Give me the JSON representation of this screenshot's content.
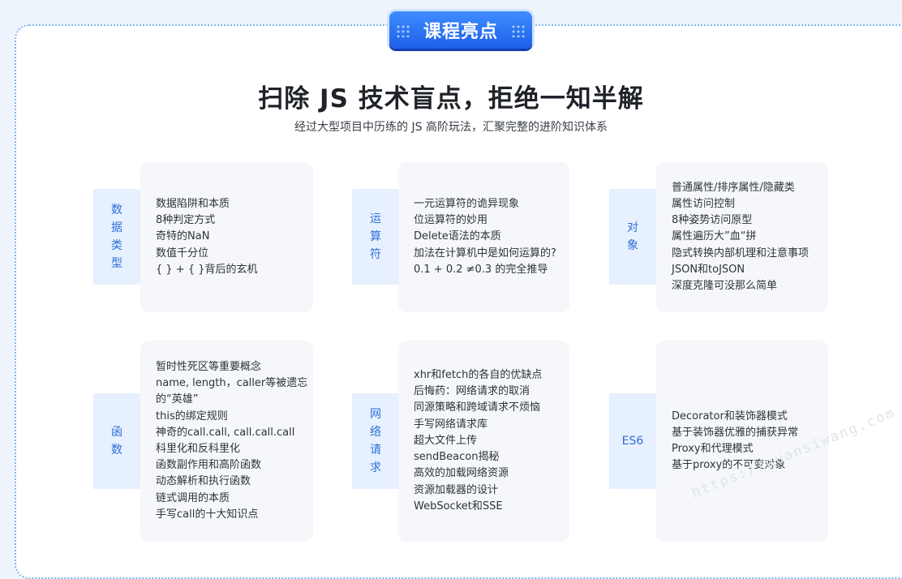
{
  "badge": "课程亮点",
  "title": "扫除 JS 技术盲点，拒绝一知半解",
  "subtitle": "经过大型项目中历练的 JS 高阶玩法，汇聚完整的进阶知识体系",
  "sections": [
    {
      "label_chars": [
        "数",
        "据",
        "类",
        "型"
      ],
      "items": [
        "数据陷阱和本质",
        "8种判定方式",
        "奇特的NaN",
        "数值千分位",
        "{ } + { }背后的玄机"
      ]
    },
    {
      "label_chars": [
        "运",
        "算",
        "符"
      ],
      "items": [
        "一元运算符的诡异现象",
        "位运算符的妙用",
        "Delete语法的本质",
        "加法在计算机中是如何运算的?",
        "0.1 + 0.2 ≠0.3 的完全推导"
      ]
    },
    {
      "label_chars": [
        "对",
        "象"
      ],
      "items": [
        "普通属性/排序属性/隐藏类",
        "属性访问控制",
        "8种姿势访问原型",
        "属性遍历大”血“拼",
        "隐式转换内部机理和注意事项",
        "JSON和toJSON",
        "深度克隆可没那么简单"
      ]
    },
    {
      "label_chars": [
        "函",
        "数"
      ],
      "items": [
        "暂时性死区等重要概念",
        "name, length，caller等被遗忘",
        "的“英雄”",
        "this的绑定规则",
        "神奇的call.call, call.call.call",
        "科里化和反科里化",
        "函数副作用和高阶函数",
        "动态解析和执行函数",
        "链式调用的本质",
        "手写call的十大知识点"
      ]
    },
    {
      "label_chars": [
        "网",
        "络",
        "请",
        "求"
      ],
      "items": [
        "xhr和fetch的各自的优缺点",
        "后悔药：网络请求的取消",
        "同源策略和跨域请求不烦恼",
        "手写网络请求库",
        "超大文件上传",
        "sendBeacon揭秘",
        "高效的加载网络资源",
        "资源加载器的设计",
        "WebSocket和SSE"
      ]
    },
    {
      "label_chars": [
        "ES6"
      ],
      "items": [
        "Decorator和装饰器模式",
        "基于装饰器优雅的捕获异常",
        "Proxy和代理模式",
        "基于proxy的不可变对象"
      ]
    }
  ],
  "watermark": "https://guansiwang.com"
}
